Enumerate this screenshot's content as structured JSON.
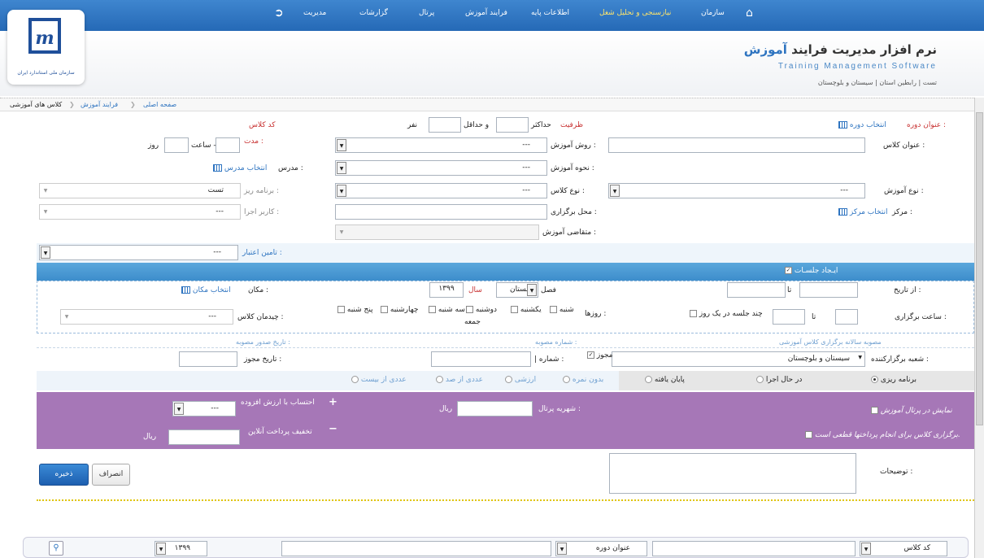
{
  "nav": {
    "home_icon": "home-icon",
    "items": [
      "سازمان",
      "نیازسنجی و تحلیل شغل",
      "اطلاعات پایه",
      "فرایند آموزش",
      "پرتال",
      "گزارشات",
      "مدیریت"
    ],
    "logout_icon": "logout-icon"
  },
  "header": {
    "title_main": "نرم افزار مدیریت فرایند",
    "title_accent": "آموزش",
    "subtitle": "Training Management Software",
    "user_line": "تست  |  رابطین استان  |  سیستان و بلوچستان",
    "org_name": "سازمان ملی استاندارد ایران"
  },
  "breadcrumb": {
    "home": "صفحه اصلی",
    "parent": "فرایند آموزش",
    "current": "کلاس های آموزشی"
  },
  "form": {
    "course_title_label": "عنوان دوره :",
    "select_course": "انتخاب دوره",
    "capacity_label": "ظرفیت",
    "max_label": "حداکثر",
    "min_label": "و حداقل",
    "person_label": "نفر",
    "class_code_label": "کد کلاس",
    "class_title_label": "عنوان کلاس :",
    "method_label": "روش آموزش :",
    "method_value": "---",
    "duration_label": "مدت :",
    "hour_label": "ساعت -",
    "day_label": "روز",
    "type_label": "نحوه آموزش :",
    "type_value": "---",
    "teacher_label": "مدرس :",
    "select_teacher": "انتخاب مدرس",
    "edu_type_label": "نوع آموزش :",
    "edu_type_value": "---",
    "class_type_label": "نوع کلاس :",
    "class_type_value": "---",
    "planner_label": "برنامه ریز :",
    "planner_value": "تست",
    "center_label": "مرکز :",
    "select_center": "انتخاب مرکز",
    "venue_label": "محل برگزاری :",
    "executor_label": "کاربر اجرا :",
    "executor_value": "---",
    "requester_label": "متقاضی آموزش :",
    "funding_label": "تامین اعتبار :",
    "funding_value": "---"
  },
  "sessions": {
    "create_label": "ایـجاد جلسـات",
    "from_date_label": "از تاریخ :",
    "to_label": "تا",
    "season_label": "فصل",
    "season_value": "تابستان",
    "year_label": "سال",
    "year_value": "۱۳۹۹",
    "place_label": "مکان :",
    "select_place": "انتخاب مکان",
    "time_label": "ساعت برگزاری :",
    "time_to_label": "تا",
    "multi_session_label": "چند جلسه در یک روز",
    "days_label": "روزها :",
    "days": [
      "شنبه",
      "یکشنبه",
      "دوشنبه",
      "سه شنبه",
      "چهارشنبه",
      "پنج شنبه",
      "جمعه"
    ],
    "layout_label": "چیدمان کلاس :",
    "layout_value": "---"
  },
  "approval": {
    "annual_label": "مصوبه سالانه برگزاری کلاس آموزشی",
    "approval_no_label": "شماره مصوبه :",
    "approval_date_label": "تاریخ صدور مصوبه :",
    "branch_label": "شعبه برگزارکننده :",
    "branch_value": "سیستان و بلوچستان",
    "permit_label": "مجوز",
    "number_label": "| شماره :",
    "permit_date_label": "تاریخ مجوز :"
  },
  "status_radios": [
    "برنامه ریزی",
    "در حال اجرا",
    "پایان یافته"
  ],
  "score_radios": [
    "بدون نمره",
    "ارزشی",
    "عددی از صد",
    "عددی از بیست"
  ],
  "payment": {
    "show_portal_label": "نمایش در پرتال آموزش",
    "mandatory_label": "برگزاری کلاس برای انجام پرداختها قطعی است.",
    "portal_fee_label": "شهریه پرتال :",
    "rial": "ریال",
    "vat_label": "احتساب با ارزش افزوده",
    "vat_value": "---",
    "online_discount_label": "تخفیف پرداخت آنلاین"
  },
  "description_label": "توضیحات :",
  "buttons": {
    "save": "ذخیره",
    "cancel": "انصراف"
  },
  "filter_bar": {
    "class_code": "کد کلاس",
    "course_title": "عنوان دوره",
    "year_value": "۱۳۹۹"
  }
}
